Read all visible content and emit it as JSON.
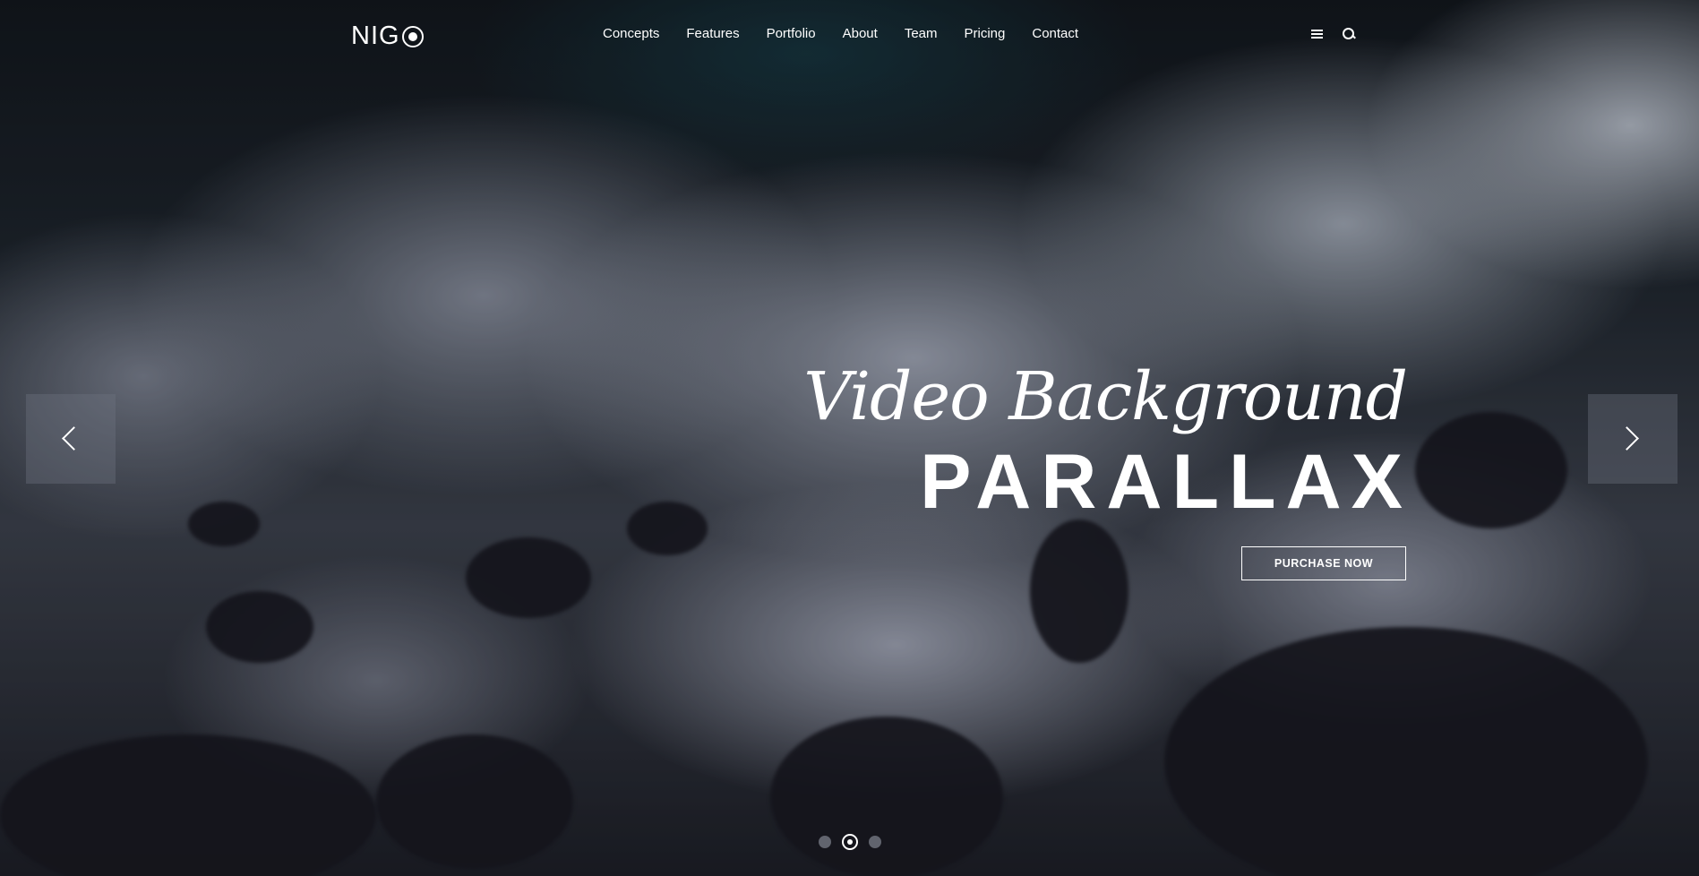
{
  "brand": {
    "logo_text": "NIG"
  },
  "nav": {
    "items": [
      {
        "label": "Concepts"
      },
      {
        "label": "Features"
      },
      {
        "label": "Portfolio"
      },
      {
        "label": "About"
      },
      {
        "label": "Team"
      },
      {
        "label": "Pricing"
      },
      {
        "label": "Contact"
      }
    ],
    "icons": [
      "menu-icon",
      "search-icon"
    ]
  },
  "hero": {
    "script_title": "Video Background",
    "main_title": "PARALLAX",
    "cta_label": "PURCHASE NOW",
    "slider": {
      "slide_count": 3,
      "active_index": 1
    }
  },
  "colors": {
    "text": "#ffffff",
    "arrow_box": "#6e7480",
    "overlay": "#0f1219"
  }
}
